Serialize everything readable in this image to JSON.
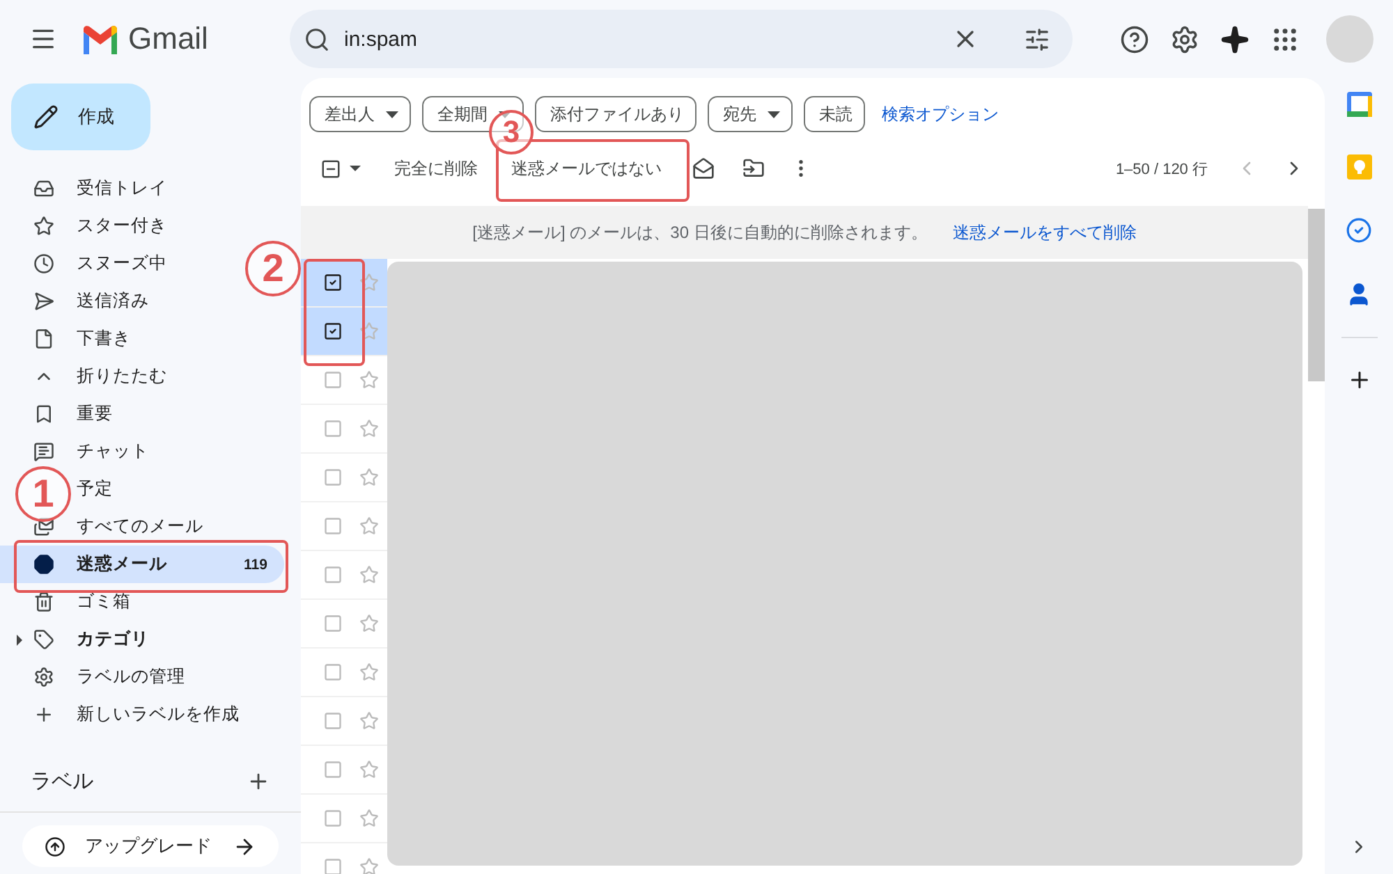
{
  "header": {
    "app_name": "Gmail",
    "search": {
      "value": "in:spam"
    }
  },
  "compose": {
    "label": "作成"
  },
  "sidebar": {
    "items": [
      {
        "label": "受信トレイ",
        "kind": "item",
        "selected": false
      },
      {
        "label": "スター付き",
        "kind": "item",
        "selected": false
      },
      {
        "label": "スヌーズ中",
        "kind": "item",
        "selected": false
      },
      {
        "label": "送信済み",
        "kind": "item",
        "selected": false
      },
      {
        "label": "下書き",
        "kind": "item",
        "selected": false
      },
      {
        "label": "折りたたむ",
        "kind": "item",
        "selected": false
      },
      {
        "label": "重要",
        "kind": "item",
        "selected": false
      },
      {
        "label": "チャット",
        "kind": "item",
        "selected": false
      },
      {
        "label": "予定",
        "kind": "item",
        "selected": false
      },
      {
        "label": "すべてのメール",
        "kind": "item",
        "selected": false
      },
      {
        "label": "迷惑メール",
        "kind": "item",
        "selected": true,
        "count": "119"
      },
      {
        "label": "ゴミ箱",
        "kind": "item",
        "selected": false
      },
      {
        "label": "カテゴリ",
        "kind": "group",
        "selected": false
      },
      {
        "label": "ラベルの管理",
        "kind": "item",
        "selected": false
      },
      {
        "label": "新しいラベルを作成",
        "kind": "item",
        "selected": false
      }
    ],
    "labels_header": "ラベル",
    "upgrade": "アップグレード"
  },
  "filters": {
    "chips": [
      {
        "label": "差出人",
        "dropdown": true
      },
      {
        "label": "全期間",
        "dropdown": true
      },
      {
        "label": "添付ファイルあり",
        "dropdown": false
      },
      {
        "label": "宛先",
        "dropdown": true
      },
      {
        "label": "未読",
        "dropdown": false
      }
    ],
    "link": "検索オプション"
  },
  "toolbar": {
    "select_all": {
      "indeterminate": true
    },
    "actions": [
      "完全に削除",
      "迷惑メールではない"
    ],
    "pagination": "1–50 / 120 行"
  },
  "notice": {
    "text": "[迷惑メール] のメールは、30 日後に自動的に削除されます。",
    "link": "迷惑メールをすべて削除"
  },
  "messages": [
    {
      "checked": true
    },
    {
      "checked": true
    },
    {
      "checked": false
    },
    {
      "checked": false
    },
    {
      "checked": false
    },
    {
      "checked": false
    },
    {
      "checked": false
    },
    {
      "checked": false
    },
    {
      "checked": false
    },
    {
      "checked": false
    },
    {
      "checked": false
    },
    {
      "checked": false
    },
    {
      "checked": false
    }
  ],
  "annotations": [
    "1",
    "2",
    "3"
  ]
}
